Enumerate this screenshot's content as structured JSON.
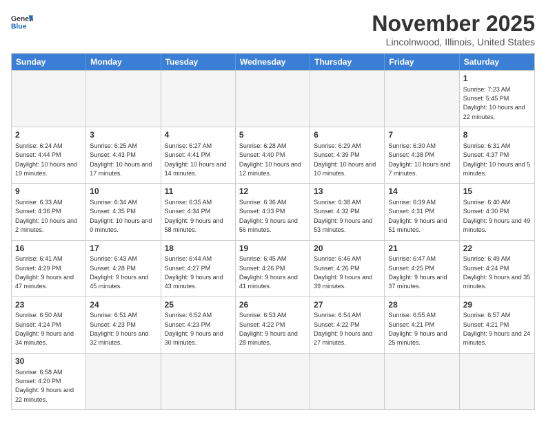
{
  "logo": {
    "text_general": "General",
    "text_blue": "Blue"
  },
  "header": {
    "month": "November 2025",
    "location": "Lincolnwood, Illinois, United States"
  },
  "days_of_week": [
    "Sunday",
    "Monday",
    "Tuesday",
    "Wednesday",
    "Thursday",
    "Friday",
    "Saturday"
  ],
  "rows": [
    [
      {
        "day": "",
        "info": ""
      },
      {
        "day": "",
        "info": ""
      },
      {
        "day": "",
        "info": ""
      },
      {
        "day": "",
        "info": ""
      },
      {
        "day": "",
        "info": ""
      },
      {
        "day": "",
        "info": ""
      },
      {
        "day": "1",
        "info": "Sunrise: 7:23 AM\nSunset: 5:45 PM\nDaylight: 10 hours and 22 minutes."
      }
    ],
    [
      {
        "day": "2",
        "info": "Sunrise: 6:24 AM\nSunset: 4:44 PM\nDaylight: 10 hours and 19 minutes."
      },
      {
        "day": "3",
        "info": "Sunrise: 6:25 AM\nSunset: 4:43 PM\nDaylight: 10 hours and 17 minutes."
      },
      {
        "day": "4",
        "info": "Sunrise: 6:27 AM\nSunset: 4:41 PM\nDaylight: 10 hours and 14 minutes."
      },
      {
        "day": "5",
        "info": "Sunrise: 6:28 AM\nSunset: 4:40 PM\nDaylight: 10 hours and 12 minutes."
      },
      {
        "day": "6",
        "info": "Sunrise: 6:29 AM\nSunset: 4:39 PM\nDaylight: 10 hours and 10 minutes."
      },
      {
        "day": "7",
        "info": "Sunrise: 6:30 AM\nSunset: 4:38 PM\nDaylight: 10 hours and 7 minutes."
      },
      {
        "day": "8",
        "info": "Sunrise: 6:31 AM\nSunset: 4:37 PM\nDaylight: 10 hours and 5 minutes."
      }
    ],
    [
      {
        "day": "9",
        "info": "Sunrise: 6:33 AM\nSunset: 4:36 PM\nDaylight: 10 hours and 2 minutes."
      },
      {
        "day": "10",
        "info": "Sunrise: 6:34 AM\nSunset: 4:35 PM\nDaylight: 10 hours and 0 minutes."
      },
      {
        "day": "11",
        "info": "Sunrise: 6:35 AM\nSunset: 4:34 PM\nDaylight: 9 hours and 58 minutes."
      },
      {
        "day": "12",
        "info": "Sunrise: 6:36 AM\nSunset: 4:33 PM\nDaylight: 9 hours and 56 minutes."
      },
      {
        "day": "13",
        "info": "Sunrise: 6:38 AM\nSunset: 4:32 PM\nDaylight: 9 hours and 53 minutes."
      },
      {
        "day": "14",
        "info": "Sunrise: 6:39 AM\nSunset: 4:31 PM\nDaylight: 9 hours and 51 minutes."
      },
      {
        "day": "15",
        "info": "Sunrise: 6:40 AM\nSunset: 4:30 PM\nDaylight: 9 hours and 49 minutes."
      }
    ],
    [
      {
        "day": "16",
        "info": "Sunrise: 6:41 AM\nSunset: 4:29 PM\nDaylight: 9 hours and 47 minutes."
      },
      {
        "day": "17",
        "info": "Sunrise: 6:43 AM\nSunset: 4:28 PM\nDaylight: 9 hours and 45 minutes."
      },
      {
        "day": "18",
        "info": "Sunrise: 6:44 AM\nSunset: 4:27 PM\nDaylight: 9 hours and 43 minutes."
      },
      {
        "day": "19",
        "info": "Sunrise: 6:45 AM\nSunset: 4:26 PM\nDaylight: 9 hours and 41 minutes."
      },
      {
        "day": "20",
        "info": "Sunrise: 6:46 AM\nSunset: 4:26 PM\nDaylight: 9 hours and 39 minutes."
      },
      {
        "day": "21",
        "info": "Sunrise: 6:47 AM\nSunset: 4:25 PM\nDaylight: 9 hours and 37 minutes."
      },
      {
        "day": "22",
        "info": "Sunrise: 6:49 AM\nSunset: 4:24 PM\nDaylight: 9 hours and 35 minutes."
      }
    ],
    [
      {
        "day": "23",
        "info": "Sunrise: 6:50 AM\nSunset: 4:24 PM\nDaylight: 9 hours and 34 minutes."
      },
      {
        "day": "24",
        "info": "Sunrise: 6:51 AM\nSunset: 4:23 PM\nDaylight: 9 hours and 32 minutes."
      },
      {
        "day": "25",
        "info": "Sunrise: 6:52 AM\nSunset: 4:23 PM\nDaylight: 9 hours and 30 minutes."
      },
      {
        "day": "26",
        "info": "Sunrise: 6:53 AM\nSunset: 4:22 PM\nDaylight: 9 hours and 28 minutes."
      },
      {
        "day": "27",
        "info": "Sunrise: 6:54 AM\nSunset: 4:22 PM\nDaylight: 9 hours and 27 minutes."
      },
      {
        "day": "28",
        "info": "Sunrise: 6:55 AM\nSunset: 4:21 PM\nDaylight: 9 hours and 25 minutes."
      },
      {
        "day": "29",
        "info": "Sunrise: 6:57 AM\nSunset: 4:21 PM\nDaylight: 9 hours and 24 minutes."
      }
    ],
    [
      {
        "day": "30",
        "info": "Sunrise: 6:58 AM\nSunset: 4:20 PM\nDaylight: 9 hours and 22 minutes."
      },
      {
        "day": "",
        "info": ""
      },
      {
        "day": "",
        "info": ""
      },
      {
        "day": "",
        "info": ""
      },
      {
        "day": "",
        "info": ""
      },
      {
        "day": "",
        "info": ""
      },
      {
        "day": "",
        "info": ""
      }
    ]
  ]
}
